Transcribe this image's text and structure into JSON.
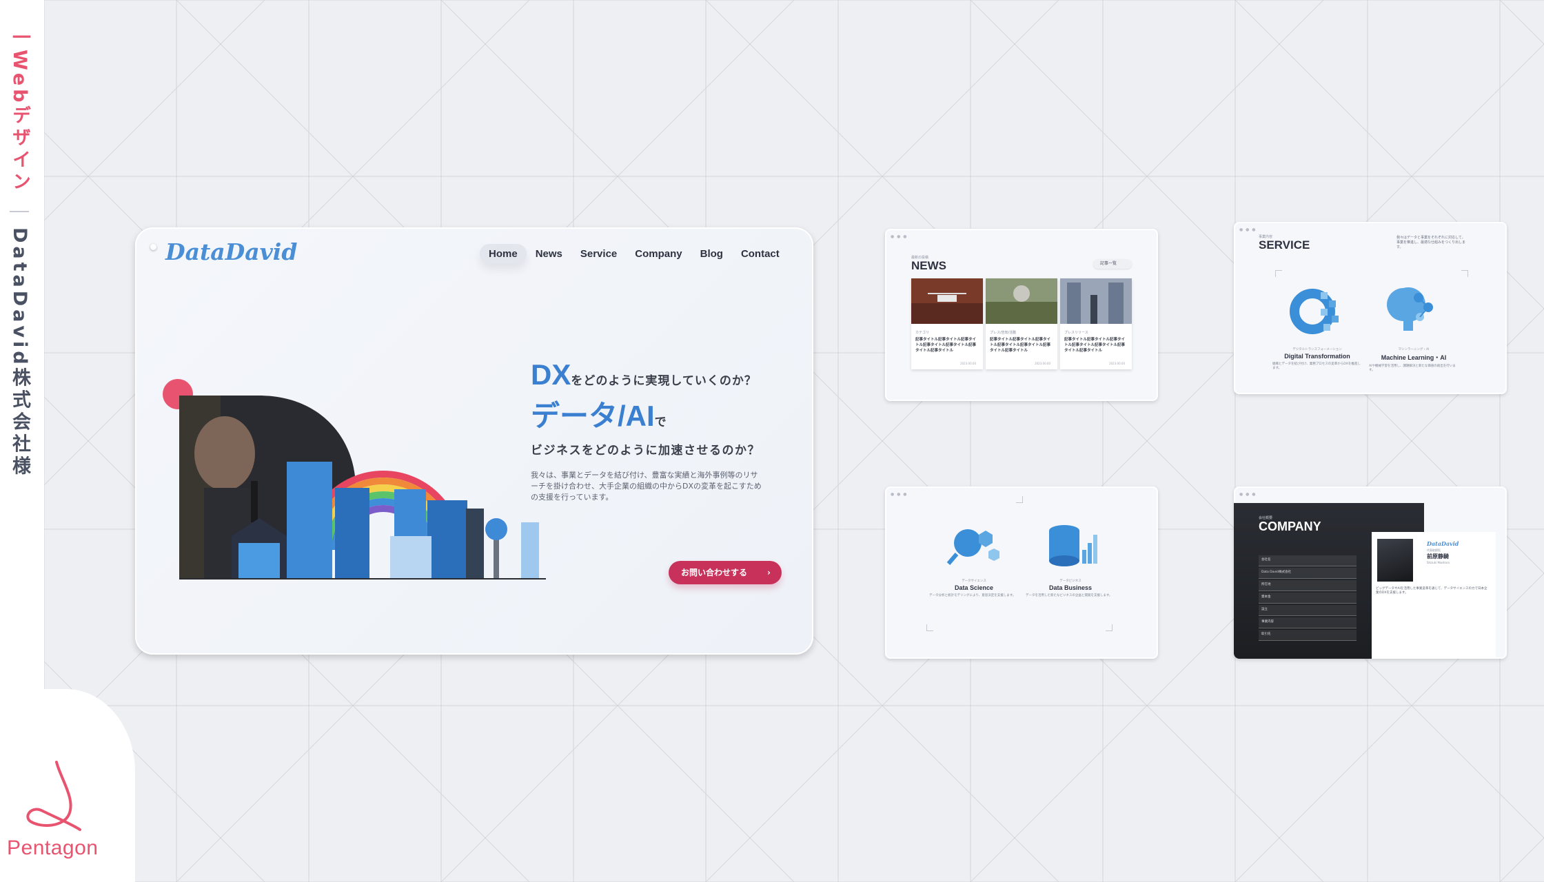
{
  "sidebar": {
    "category_label": "一Webデザイン",
    "client_label": "DataDavid株式会社様",
    "brand": "Pentagon"
  },
  "colors": {
    "brand_pink": "#e8546f",
    "primary_blue": "#3a7fd0",
    "cta_red": "#c8315a",
    "background": "#eeeff3"
  },
  "main": {
    "logo": "DataDavid",
    "nav": [
      "Home",
      "News",
      "Service",
      "Company",
      "Blog",
      "Contact"
    ],
    "active_nav": "Home",
    "hero": {
      "line1_big": "DX",
      "line1_small": "をどのように実現していくのか？",
      "line2_big": "データ/AI",
      "line2_small": "で",
      "line3": "ビジネスをどのように加速させるのか？",
      "body": "我々は、事業とデータを結び付け、豊富な実績と海外事例等のリサーチを掛け合わせ、大手企業の組織の中からDXの変革を起こすための支援を行っています。",
      "cta": "お問い合わせする",
      "cta_icon": "chevron-right-icon"
    }
  },
  "news": {
    "kicker": "最新の投稿",
    "title": "NEWS",
    "more": "記事一覧",
    "cards": [
      {
        "category": "カテゴリ",
        "title": "記事タイトル記事タイトル記事タイトル記事タイトル記事タイトル記事タイトル記事タイトル",
        "date": "2023.00.00"
      },
      {
        "category": "プレス/告知/活動",
        "title": "記事タイトル記事タイトル記事タイトル記事タイトル記事タイトル記事タイトル記事タイトル",
        "date": "2023.00.00"
      },
      {
        "category": "プレスリリース",
        "title": "記事タイトル記事タイトル記事タイトル記事タイトル記事タイトル記事タイトル記事タイトル",
        "date": "2023.00.00"
      }
    ]
  },
  "service": {
    "kicker": "事業内容",
    "title": "SERVICE",
    "description": "我々はデータと事業をそれぞれに対応して、事業を推進し、最適な仕組みをつくり出します。",
    "items": [
      {
        "caption": "デジタルトランスフォーメーション",
        "name": "Digital Transformation",
        "text": "組織とデータを結び付け、業務プロセスの変革からDXを推進します。"
      },
      {
        "caption": "マシンラーニング・AI",
        "name": "Machine Learning・AI",
        "text": "AIや機械学習を活用し、課題解決と新たな価値の創出を行います。"
      }
    ]
  },
  "data_services": {
    "items": [
      {
        "caption": "データサイエンス",
        "name": "Data Science",
        "text": "データ分析と統計モデリングにより、意思決定を支援します。"
      },
      {
        "caption": "データビジネス",
        "name": "Data Business",
        "text": "データを活用した新たなビジネスの企画と開発を支援します。"
      }
    ]
  },
  "company": {
    "kicker": "会社概要",
    "title": "COMPANY",
    "rows": [
      "会社名",
      "Data David株式会社",
      "所在地",
      "資本金",
      "設立",
      "事業内容",
      "取引先"
    ],
    "ceo_label": "DataDavid",
    "ceo_role": "代表取締役",
    "ceo_name": "前原静騎",
    "ceo_en": "Shizuki Maehara",
    "ceo_text": "ビッグデータやAIを活用した事業変革を通じて、データサイエンスの力で日本企業のDXを支援します。"
  }
}
